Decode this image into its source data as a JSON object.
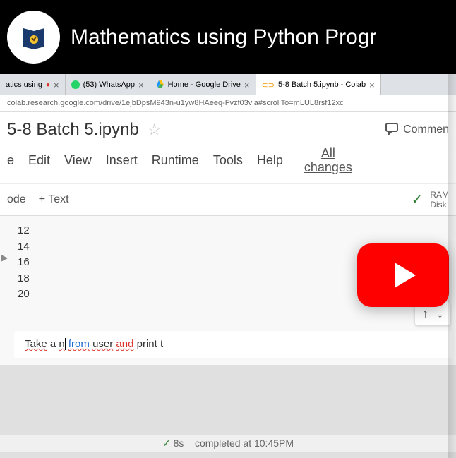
{
  "video": {
    "title": "Mathematics using Python Progr"
  },
  "tabs": [
    {
      "label": "atics using",
      "active": false
    },
    {
      "label": "(53) WhatsApp",
      "active": false
    },
    {
      "label": "Home - Google Drive",
      "active": false
    },
    {
      "label": "5-8 Batch 5.ipynb - Colab",
      "active": true
    }
  ],
  "url": "colab.research.google.com/drive/1ejbDpsM943n-u1yw8HAeeq-Fvzf03via#scrollTo=mLUL8rsf12xc",
  "notebook": {
    "title": "5-8 Batch 5.ipynb"
  },
  "menu": {
    "edit": "Edit",
    "view": "View",
    "insert": "Insert",
    "runtime": "Runtime",
    "tools": "Tools",
    "help": "Help",
    "all_changes_l1": "All",
    "all_changes_l2": "changes"
  },
  "header": {
    "comment": "Commen"
  },
  "toolbar": {
    "code": "ode",
    "text": "+ Text",
    "ram": "RAM",
    "disk": "Disk"
  },
  "output": {
    "l1": "12",
    "l2": "14",
    "l3": "16",
    "l4": "18",
    "l5": "20"
  },
  "code": {
    "p1": "Take",
    "p2": "a",
    "p3": "n",
    "p4": "from",
    "p5": "user",
    "p6": "and",
    "p7": "print t"
  },
  "status": {
    "time": "8s",
    "msg": "completed at 10:45PM"
  }
}
